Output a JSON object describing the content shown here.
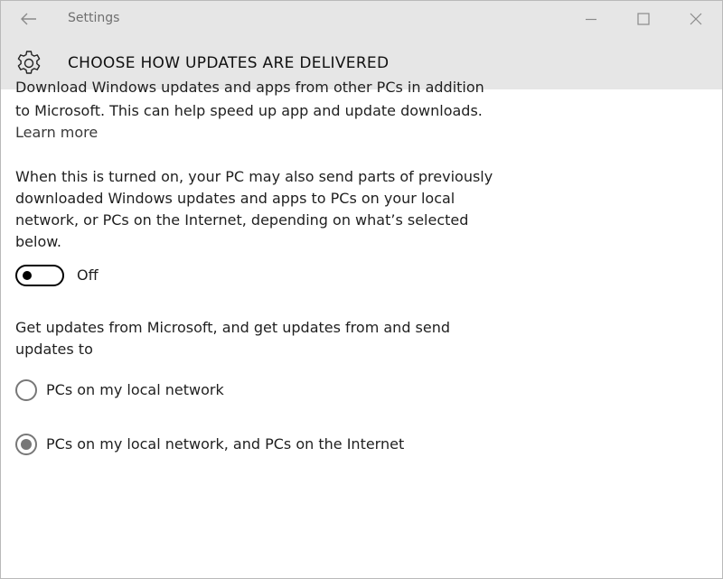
{
  "window": {
    "app_title": "Settings",
    "back_icon": "back-arrow-icon",
    "controls": [
      "minimize-icon",
      "maximize-icon",
      "close-icon"
    ]
  },
  "header": {
    "title": "CHOOSE HOW UPDATES ARE DELIVERED",
    "icon": "gear-icon"
  },
  "content": {
    "cut_line": "Download Windows updates and apps from other PCs in addition",
    "intro_text": "to Microsoft. This can help speed up app and update downloads.",
    "learn_more": "Learn more",
    "description": "When this is turned on, your PC may also send parts of previously downloaded Windows updates and apps to PCs on your local network, or PCs on the Internet, depending on what’s selected below.",
    "toggle": {
      "state_label": "Off",
      "on": false
    },
    "options_heading": "Get updates from Microsoft, and get updates from and send updates to",
    "options": [
      {
        "label": "PCs on my local network",
        "selected": false
      },
      {
        "label": "PCs on my local network, and PCs on the Internet",
        "selected": true
      }
    ]
  },
  "colors": {
    "chrome_bg": "#e6e6e6",
    "text": "#1f1f1f",
    "radio_gray": "#777777"
  }
}
